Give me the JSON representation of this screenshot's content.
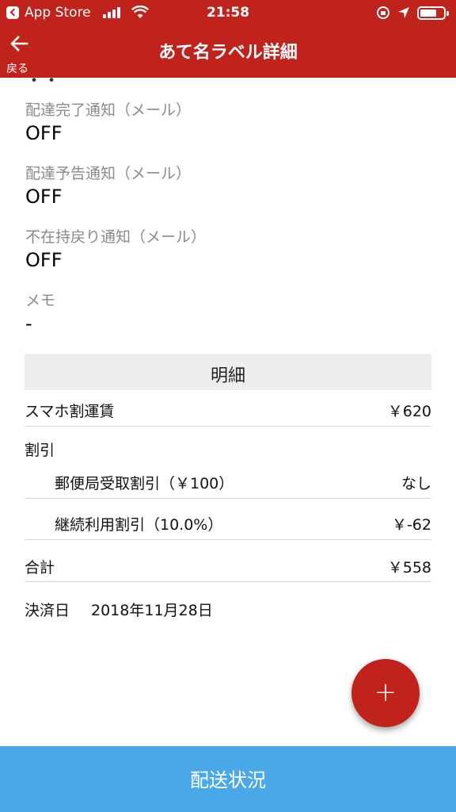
{
  "status_bar": {
    "back_app": "App Store",
    "time": "21:58"
  },
  "nav": {
    "back_label": "戻る",
    "title": "あて名ラベル詳細"
  },
  "fields": [
    {
      "label": "配達完了通知（メール）",
      "value": "OFF"
    },
    {
      "label": "配達予告通知（メール）",
      "value": "OFF"
    },
    {
      "label": "不在持戻り通知（メール）",
      "value": "OFF"
    },
    {
      "label": "メモ",
      "value": "-"
    }
  ],
  "detail": {
    "header": "明細",
    "fare_label": "スマホ割運賃",
    "fare_value": "￥620",
    "discount_label": "割引",
    "discounts": [
      {
        "label": "郵便局受取割引（￥100）",
        "value": "なし"
      },
      {
        "label": "継続利用割引（10.0%）",
        "value": "￥-62"
      }
    ],
    "total_label": "合計",
    "total_value": "￥558",
    "settlement_label": "決済日",
    "settlement_value": "2018年11月28日"
  },
  "fab_label": "+",
  "bottom_button": "配送状況",
  "colors": {
    "brand_red": "#c0231c",
    "bottom_blue": "#4aa8e8"
  }
}
